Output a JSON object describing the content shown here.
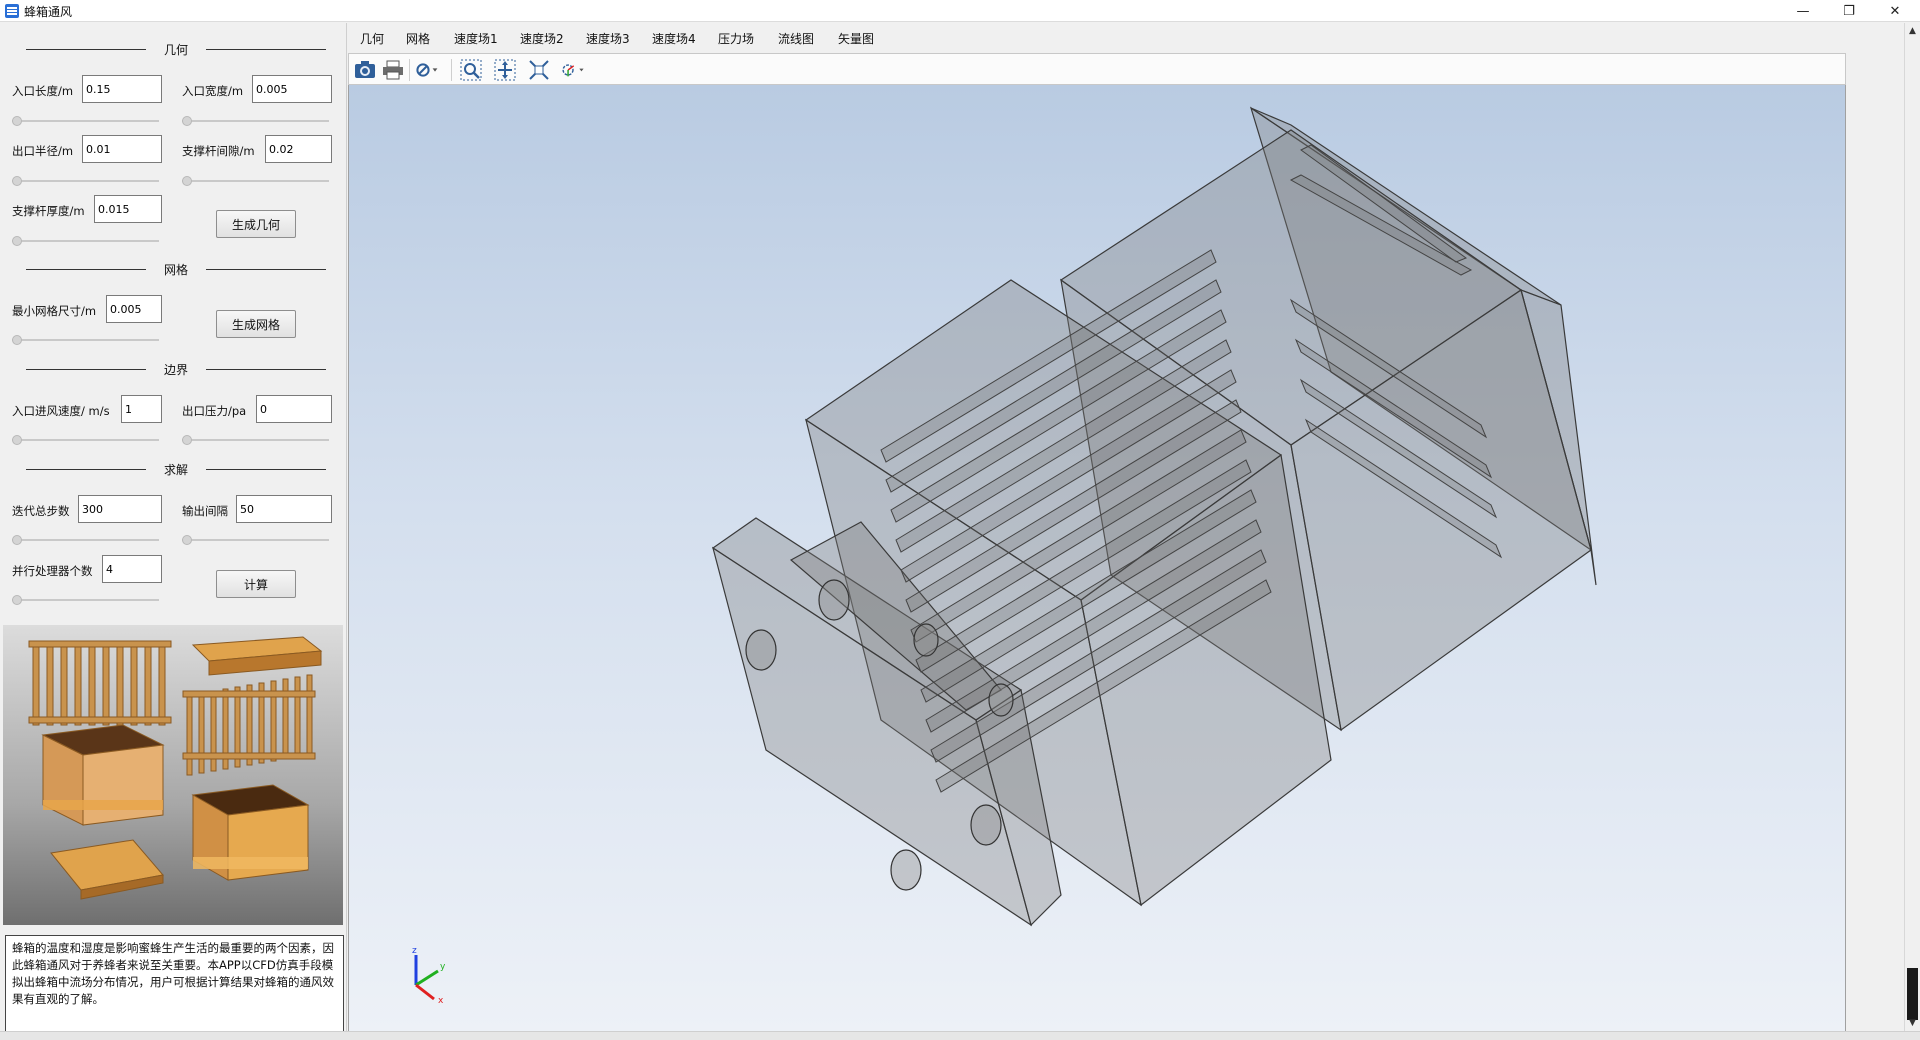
{
  "window": {
    "title": "蜂箱通风",
    "minimize": "—",
    "restore": "❐",
    "close": "✕"
  },
  "sections": {
    "geometry": "几何",
    "mesh": "网格",
    "boundary": "边界",
    "solve": "求解"
  },
  "fields": {
    "inlet_length": {
      "label": "入口长度/m",
      "value": "0.15"
    },
    "inlet_width": {
      "label": "入口宽度/m",
      "value": "0.005"
    },
    "outlet_radius": {
      "label": "出口半径/m",
      "value": "0.01"
    },
    "rod_spacing": {
      "label": "支撑杆间隙/m",
      "value": "0.02"
    },
    "rod_thickness": {
      "label": "支撑杆厚度/m",
      "value": "0.015"
    },
    "min_mesh": {
      "label": "最小网格尺寸/m",
      "value": "0.005"
    },
    "inlet_velocity": {
      "label": "入口进风速度/ m/s",
      "value": "1"
    },
    "outlet_pressure": {
      "label": "出口压力/pa",
      "value": "0"
    },
    "iterations": {
      "label": "迭代总步数",
      "value": "300"
    },
    "output_interval": {
      "label": "输出间隔",
      "value": "50"
    },
    "processors": {
      "label": "并行处理器个数",
      "value": "4"
    }
  },
  "buttons": {
    "gen_geometry": "生成几何",
    "gen_mesh": "生成网格",
    "compute": "计算"
  },
  "description": "蜂箱的温度和湿度是影响蜜蜂生产生活的最重要的两个因素，因此蜂箱通风对于养蜂者来说至关重要。本APP以CFD仿真手段模拟出蜂箱中流场分布情况，用户可根据计算结果对蜂箱的通风效果有直观的了解。",
  "tabs": [
    "几何",
    "网格",
    "速度场1",
    "速度场2",
    "速度场3",
    "速度场4",
    "压力场",
    "流线图",
    "矢量图"
  ],
  "toolbar": {
    "icons": [
      "camera-icon",
      "print-icon",
      "hide-icon",
      "zoom-box-icon",
      "zoom-extents-icon",
      "zoom-fit-icon",
      "rotate-axes-icon"
    ]
  },
  "axes": {
    "x": "x",
    "y": "y",
    "z": "z"
  },
  "colors": {
    "viewport_top": "#b9cbe2",
    "viewport_bottom": "#edf1f7",
    "model_gray": "#8a8a8a",
    "axis_x": "#e02020",
    "axis_y": "#20b020",
    "axis_z": "#2040e0"
  }
}
